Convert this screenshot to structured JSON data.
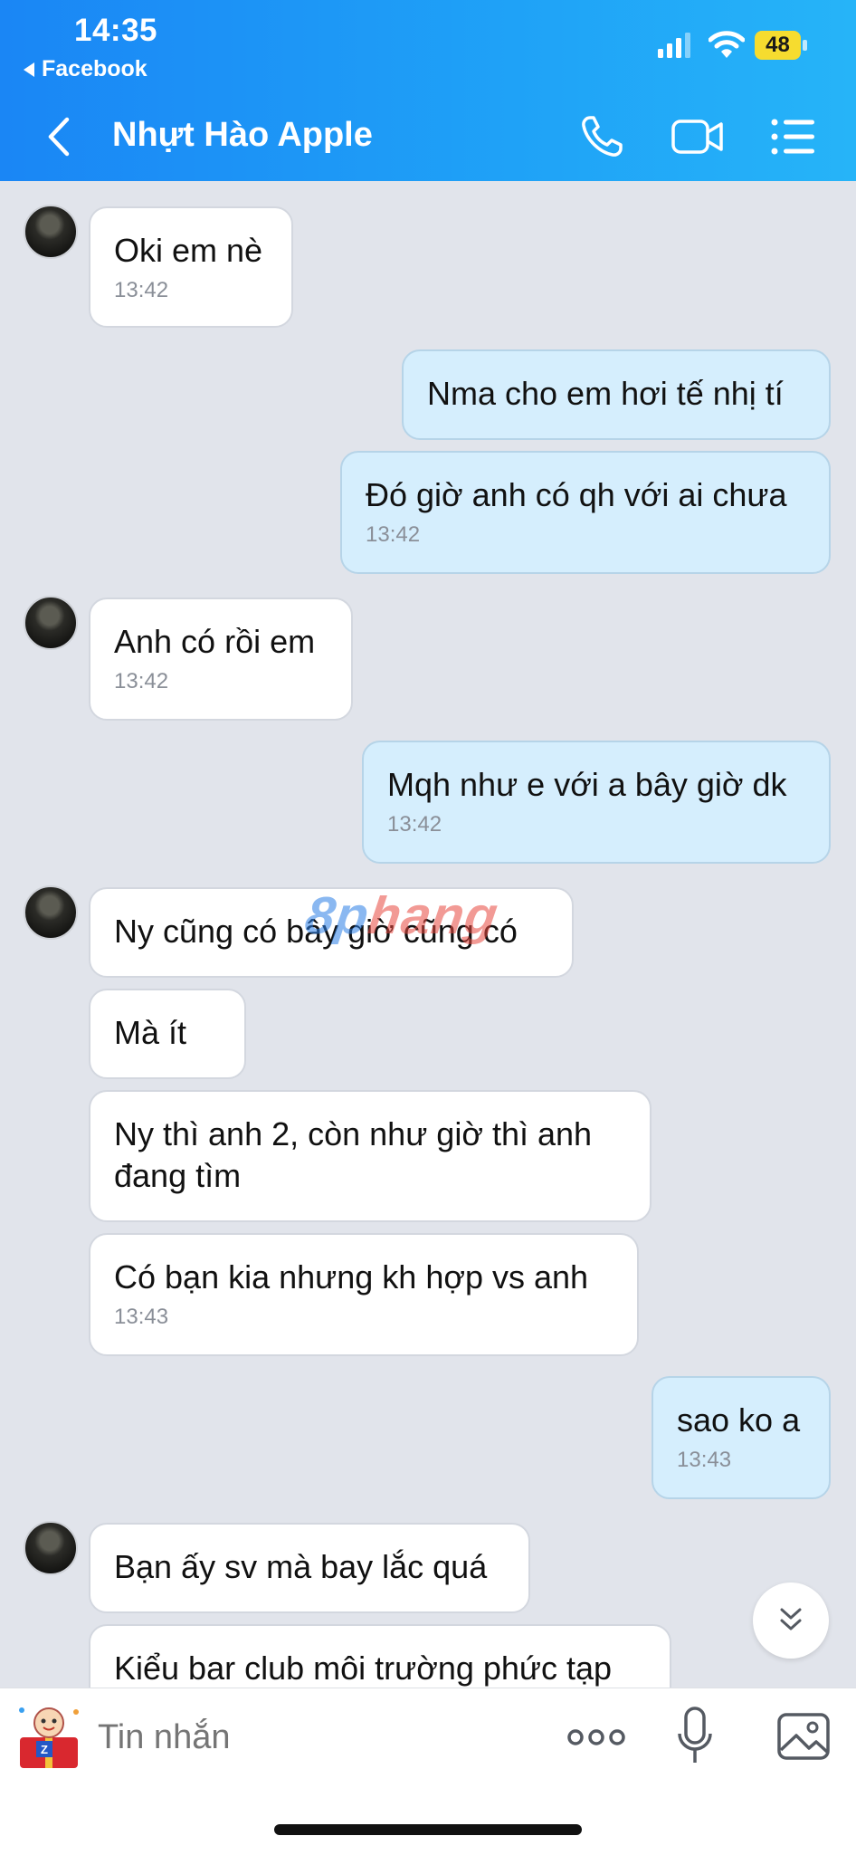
{
  "status_bar": {
    "time": "14:35",
    "back_app": "Facebook",
    "battery": "48"
  },
  "header": {
    "contact_name": "Nhựt Hào Apple"
  },
  "messages": [
    {
      "dir": "in",
      "text": "Oki em nè",
      "time": "13:42"
    },
    {
      "dir": "out",
      "text": "Nma cho em hơi tế nhị tí"
    },
    {
      "dir": "out",
      "text": "Đó giờ anh có qh với ai chưa",
      "time": "13:42"
    },
    {
      "dir": "in",
      "text": "Anh có rồi em",
      "time": "13:42"
    },
    {
      "dir": "out",
      "text": "Mqh như e với a bây giờ dk",
      "time": "13:42"
    },
    {
      "dir": "in",
      "text": "Ny cũng có bây giờ cũng có"
    },
    {
      "dir": "in",
      "text": "Mà ít"
    },
    {
      "dir": "in",
      "text": "Ny thì anh 2, còn như giờ thì anh đang tìm"
    },
    {
      "dir": "in",
      "text": "Có bạn kia nhưng kh hợp vs anh",
      "time": "13:43"
    },
    {
      "dir": "out",
      "text": "sao ko a",
      "time": "13:43"
    },
    {
      "dir": "in",
      "text": "Bạn ấy sv mà bay lắc quá"
    },
    {
      "dir": "in",
      "text": "Kiểu bar club môi trường phức tạp"
    }
  ],
  "watermark": {
    "part1": "8p",
    "part2": "hang"
  },
  "input": {
    "placeholder": "Tin nhắn"
  },
  "colors": {
    "header_start": "#1a86f5",
    "header_end": "#26b4f8",
    "outgoing_bubble": "#d5eefd",
    "incoming_bubble": "#ffffff",
    "background": "#e1e4eb"
  }
}
